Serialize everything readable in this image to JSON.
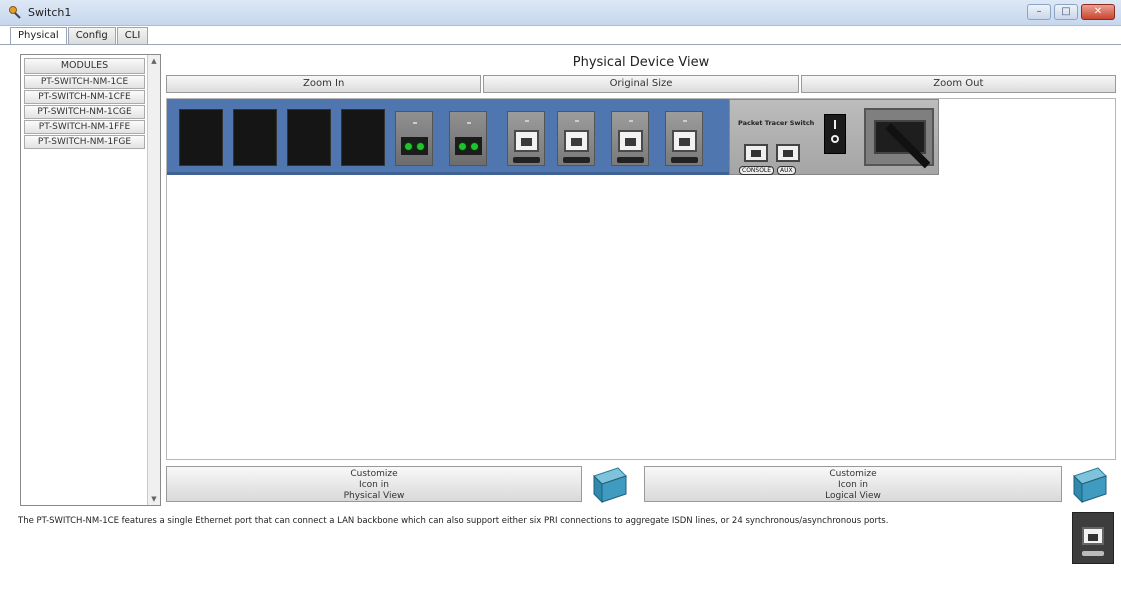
{
  "window": {
    "title": "Switch1",
    "controls": {
      "minimize": "–",
      "maximize": "□",
      "close": "✕"
    }
  },
  "tabs": [
    {
      "label": "Physical",
      "active": true
    },
    {
      "label": "Config",
      "active": false
    },
    {
      "label": "CLI",
      "active": false
    }
  ],
  "modules": {
    "header": "MODULES",
    "items": [
      "PT-SWITCH-NM-1CE",
      "PT-SWITCH-NM-1CFE",
      "PT-SWITCH-NM-1CGE",
      "PT-SWITCH-NM-1FFE",
      "PT-SWITCH-NM-1FGE"
    ],
    "scroll_up": "▲",
    "scroll_down": "▼"
  },
  "physical_view": {
    "title": "Physical Device View",
    "zoom_in": "Zoom In",
    "original_size": "Original Size",
    "zoom_out": "Zoom Out"
  },
  "device": {
    "brand": "Packet Tracer Switch",
    "console_label": "CONSOLE",
    "aux_label": "AUX",
    "empty_slots": 4,
    "fiber_ports": 2,
    "ethernet_ports": 4,
    "power_led_color": "#2ad13a",
    "chassis_color": "#4f76ae"
  },
  "customize": {
    "physical": [
      "Customize",
      "Icon in",
      "Physical View"
    ],
    "logical": [
      "Customize",
      "Icon in",
      "Logical View"
    ]
  },
  "description": "The PT-SWITCH-NM-1CE features a single Ethernet port that can connect a LAN backbone which can also support either six PRI connections to aggregate ISDN lines, or 24 synchronous/asynchronous ports."
}
